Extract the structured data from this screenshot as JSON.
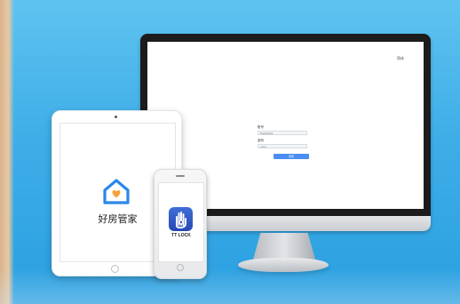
{
  "monitor": {
    "language_label": "简体",
    "login": {
      "account_label": "账号",
      "account_value": "Test Account",
      "password_label": "密码",
      "password_value": "••••••••",
      "submit_label": "登录"
    }
  },
  "tablet": {
    "app_name": "好房管家",
    "app_icon": "house-heart-icon"
  },
  "phone": {
    "app_name": "TT LOCK",
    "app_icon": "ttlock-hand-icon"
  },
  "colors": {
    "background": "#3eaee8",
    "login_button": "#4a8df3",
    "house_icon": "#2b87e8",
    "heart": "#f6a23a",
    "ttlock_icon": "#2f55c5"
  }
}
